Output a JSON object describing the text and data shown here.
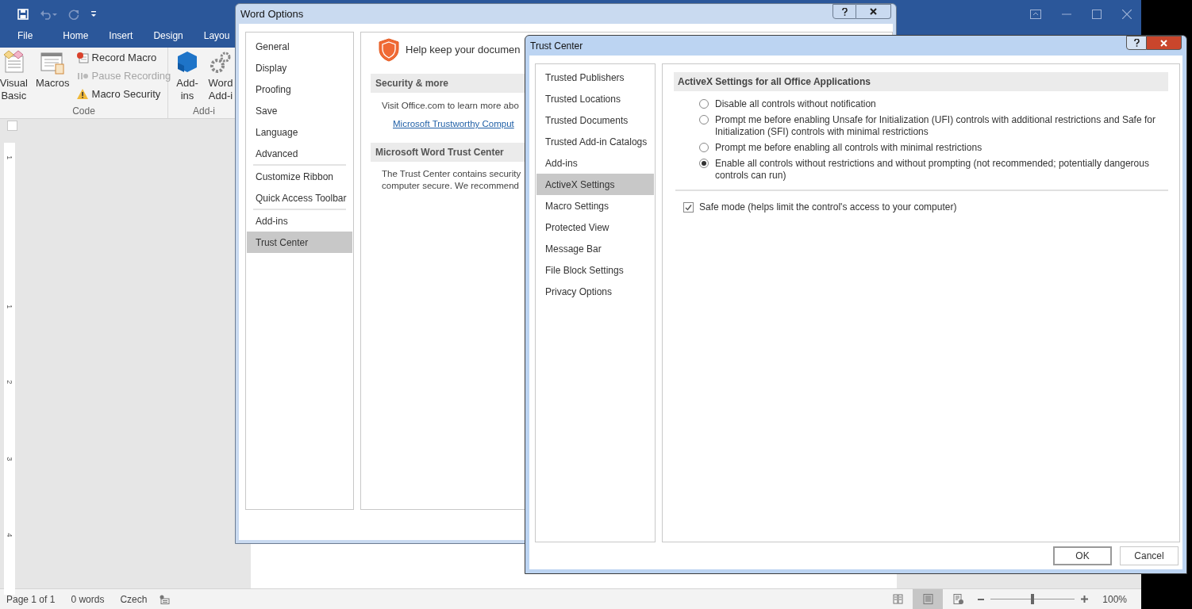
{
  "word": {
    "tabs": [
      "File",
      "Home",
      "Insert",
      "Design",
      "Layou"
    ],
    "ribbon": {
      "groups": [
        {
          "label": "Code",
          "large": [
            {
              "lines": [
                "Visual",
                "Basic"
              ]
            },
            {
              "lines": [
                "Macros"
              ]
            }
          ],
          "small": [
            {
              "label": "Record Macro",
              "disabled": false
            },
            {
              "label": "Pause Recording",
              "disabled": true
            },
            {
              "label": "Macro Security",
              "disabled": false
            }
          ]
        },
        {
          "label": "Add-i",
          "large": [
            {
              "lines": [
                "Add-",
                "ins"
              ]
            },
            {
              "lines": [
                "Word",
                "Add-i"
              ]
            }
          ]
        }
      ]
    },
    "ruler_numbers": [
      "1",
      "1",
      "2",
      "3",
      "4"
    ],
    "status_bar": {
      "page": "Page 1 of 1",
      "words": "0 words",
      "language": "Czech",
      "views": [
        {
          "selected": false
        },
        {
          "selected": true
        },
        {
          "selected": false
        }
      ],
      "zoom": {
        "level": 0.5,
        "reading": "100%"
      }
    }
  },
  "word_options": {
    "title": "Word Options",
    "nav_groups": [
      [
        {
          "label": "General",
          "selected": false
        },
        {
          "label": "Display",
          "selected": false
        },
        {
          "label": "Proofing",
          "selected": false
        },
        {
          "label": "Save",
          "selected": false
        },
        {
          "label": "Language",
          "selected": false
        },
        {
          "label": "Advanced",
          "selected": false
        }
      ],
      [
        {
          "label": "Customize Ribbon",
          "selected": false
        },
        {
          "label": "Quick Access Toolbar",
          "selected": false
        }
      ],
      [
        {
          "label": "Add-ins",
          "selected": false
        },
        {
          "label": "Trust Center",
          "selected": true
        }
      ]
    ],
    "heading": "Help keep your documen",
    "sections": [
      {
        "title": "Security & more",
        "text": "Visit Office.com to learn more abo",
        "link": "Microsoft Trustworthy Comput"
      },
      {
        "title": "Microsoft Word Trust Center",
        "lines": [
          "The Trust Center contains security",
          "computer secure. We recommend"
        ]
      }
    ]
  },
  "trust_center": {
    "title": "Trust Center",
    "nav": [
      {
        "label": "Trusted Publishers",
        "selected": false
      },
      {
        "label": "Trusted Locations",
        "selected": false
      },
      {
        "label": "Trusted Documents",
        "selected": false
      },
      {
        "label": "Trusted Add-in Catalogs",
        "selected": false
      },
      {
        "label": "Add-ins",
        "selected": false
      },
      {
        "label": "ActiveX Settings",
        "selected": true
      },
      {
        "label": "Macro Settings",
        "selected": false
      },
      {
        "label": "Protected View",
        "selected": false
      },
      {
        "label": "Message Bar",
        "selected": false
      },
      {
        "label": "File Block Settings",
        "selected": false
      },
      {
        "label": "Privacy Options",
        "selected": false
      }
    ],
    "section_title": "ActiveX Settings for all Office Applications",
    "options": [
      {
        "label": "Disable all controls without notification",
        "selected": false
      },
      {
        "label": "Prompt me before enabling Unsafe for Initialization (UFI) controls with additional restrictions and Safe for Initialization (SFI) controls with minimal restrictions",
        "selected": false
      },
      {
        "label": "Prompt me before enabling all controls with minimal restrictions",
        "selected": false
      },
      {
        "label": "Enable all controls without restrictions and without prompting (not recommended; potentially dangerous controls can run)",
        "selected": true
      }
    ],
    "safe_mode": {
      "label": "Safe mode (helps limit the control's access to your computer)",
      "checked": true
    },
    "buttons": [
      {
        "label": "OK",
        "default": true
      },
      {
        "label": "Cancel",
        "default": false
      }
    ]
  }
}
